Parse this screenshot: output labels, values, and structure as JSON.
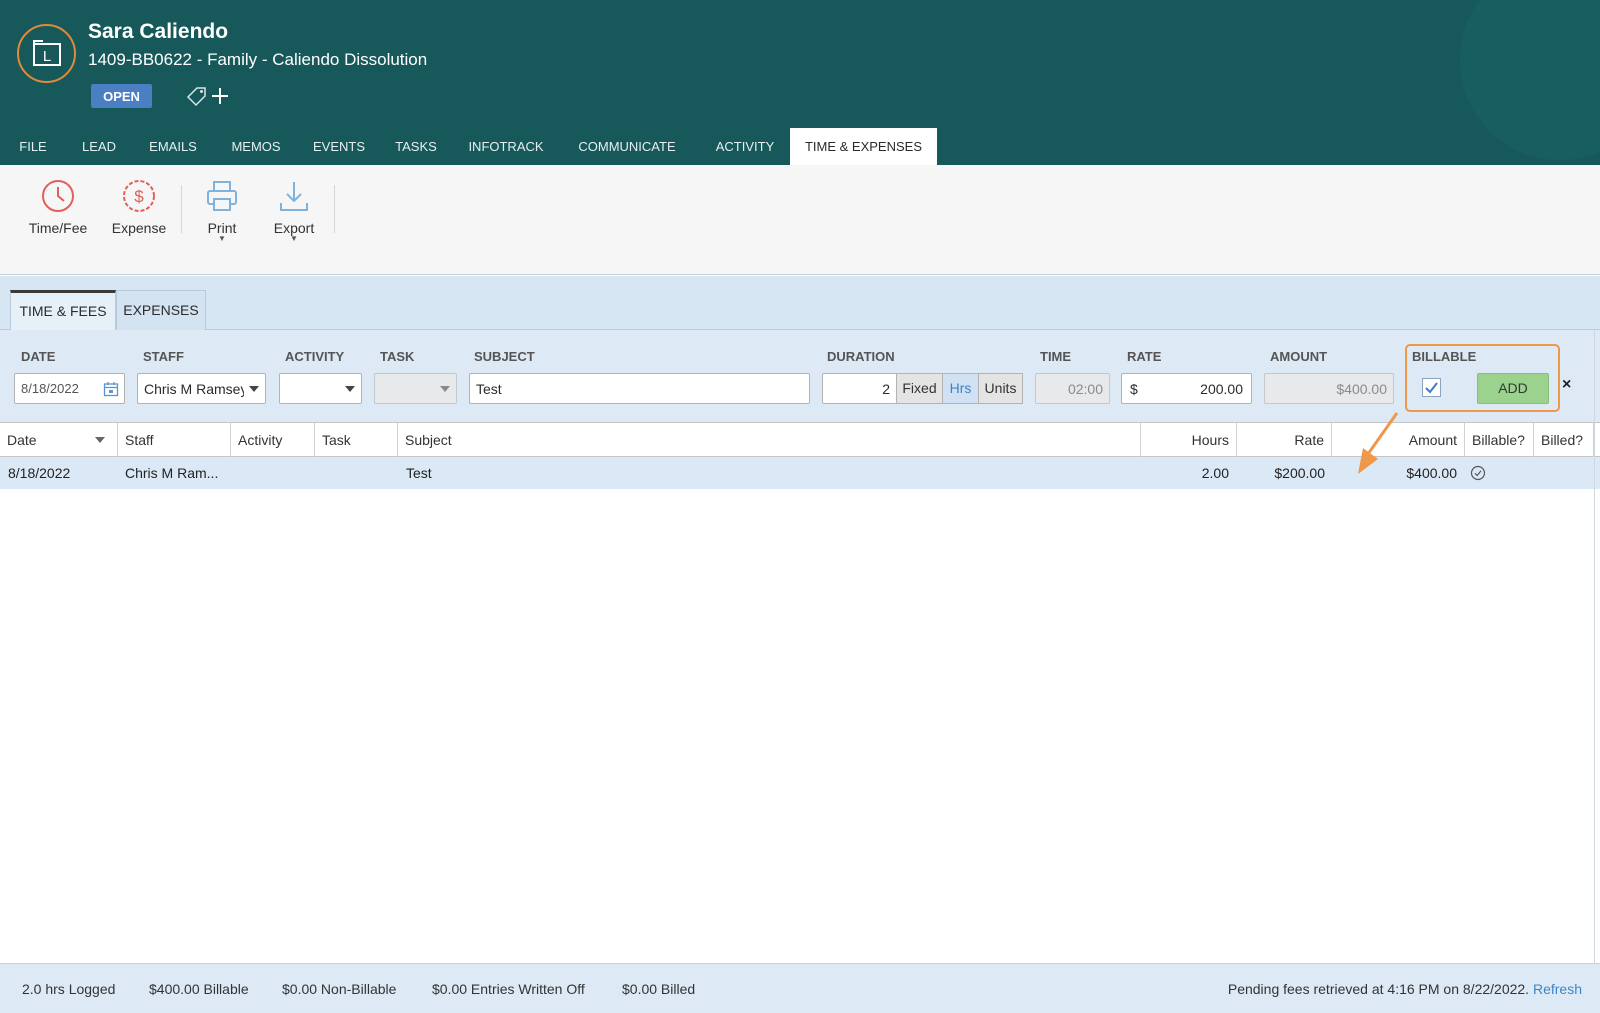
{
  "header": {
    "client_name": "Sara Caliendo",
    "matter_title": "1409-BB0622 - Family - Caliendo Dissolution",
    "status": "OPEN",
    "logo_letter": "L",
    "tabs": [
      {
        "label": "FILE"
      },
      {
        "label": "LEAD"
      },
      {
        "label": "EMAILS"
      },
      {
        "label": "MEMOS"
      },
      {
        "label": "EVENTS"
      },
      {
        "label": "TASKS"
      },
      {
        "label": "INFOTRACK"
      },
      {
        "label": "COMMUNICATE"
      },
      {
        "label": "ACTIVITY"
      },
      {
        "label": "TIME & EXPENSES",
        "active": true
      }
    ]
  },
  "toolbar": {
    "time_fee": "Time/Fee",
    "expense": "Expense",
    "print": "Print",
    "export": "Export"
  },
  "subtabs": {
    "time_fees": "TIME & FEES",
    "expenses": "EXPENSES"
  },
  "entry": {
    "labels": {
      "date": "DATE",
      "staff": "STAFF",
      "activity": "ACTIVITY",
      "task": "TASK",
      "subject": "SUBJECT",
      "duration": "DURATION",
      "time": "TIME",
      "rate": "RATE",
      "amount": "AMOUNT",
      "billable": "BILLABLE"
    },
    "date": "8/18/2022",
    "staff": "Chris M Ramsey",
    "activity": "",
    "task": "",
    "subject": "Test",
    "duration": "2",
    "duration_modes": [
      "Fixed",
      "Hrs",
      "Units"
    ],
    "duration_selected": "Hrs",
    "time": "02:00",
    "rate_currency": "$",
    "rate": "200.00",
    "amount": "$400.00",
    "billable_checked": true,
    "add_label": "ADD",
    "close_label": "×"
  },
  "grid": {
    "columns": [
      "Date",
      "Staff",
      "Activity",
      "Task",
      "Subject",
      "Hours",
      "Rate",
      "Amount",
      "Billable?",
      "Billed?"
    ],
    "rows": [
      {
        "date": "8/18/2022",
        "staff": "Chris M Ram...",
        "activity": "",
        "task": "",
        "subject": "Test",
        "hours": "2.00",
        "rate": "$200.00",
        "amount": "$400.00",
        "billable": true,
        "billed": false
      }
    ]
  },
  "footer": {
    "logged": "2.0 hrs Logged",
    "billable": "$400.00 Billable",
    "non_billable": "$0.00 Non-Billable",
    "written_off": "$0.00 Entries Written Off",
    "billed": "$0.00 Billed",
    "pending": "Pending fees retrieved at 4:16 PM on 8/22/2022.",
    "refresh": "Refresh"
  },
  "colors": {
    "header_bg": "#17595a",
    "accent_orange": "#f0974a",
    "status_blue": "#4b7fc3",
    "add_green": "#9bd28e",
    "link_blue": "#3d86c9"
  },
  "icons": {
    "time_fee": "clock-icon",
    "expense": "dollar-circle-icon",
    "print": "printer-icon",
    "export": "download-icon"
  }
}
